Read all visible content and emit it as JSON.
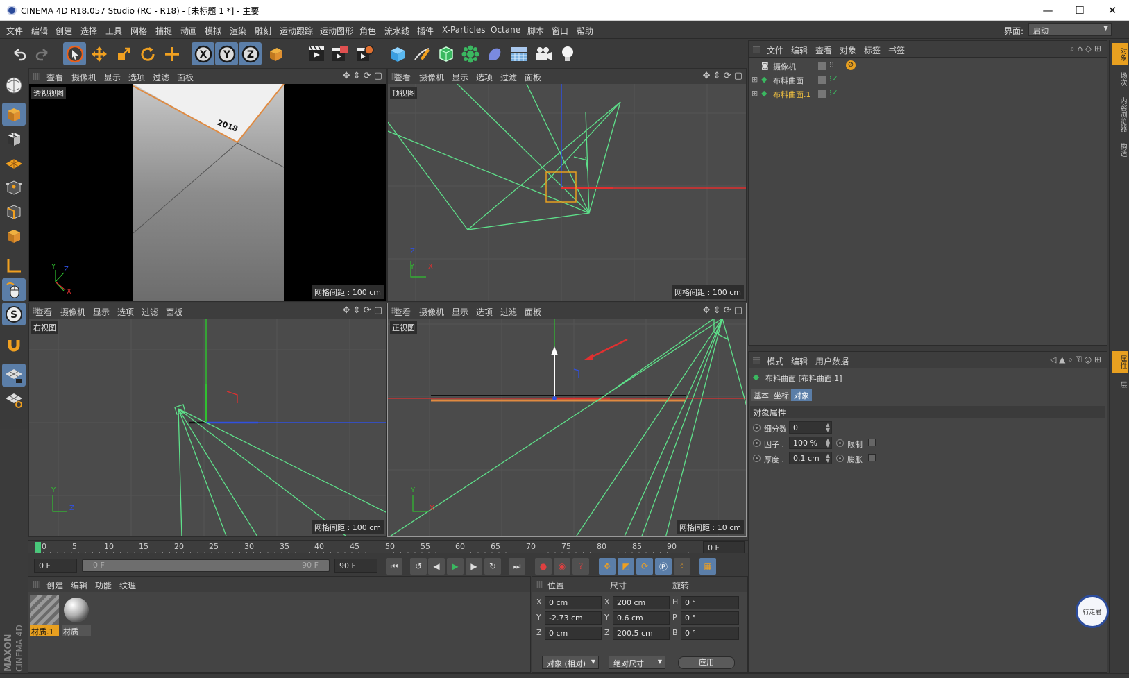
{
  "window": {
    "title": "CINEMA 4D R18.057 Studio (RC - R18) - [未标题 1 *] - 主要",
    "minimize": "—",
    "maximize": "☐",
    "close": "✕"
  },
  "menu": [
    "文件",
    "编辑",
    "创建",
    "选择",
    "工具",
    "网格",
    "捕捉",
    "动画",
    "模拟",
    "渲染",
    "雕刻",
    "运动跟踪",
    "运动图形",
    "角色",
    "流水线",
    "插件",
    "X-Particles",
    "Octane",
    "脚本",
    "窗口",
    "帮助"
  ],
  "layout": {
    "label": "界面:",
    "value": "启动"
  },
  "toolbar_icons": [
    "undo-icon",
    "redo-icon",
    "live-select-icon",
    "move-icon",
    "scale-icon",
    "rotate-icon",
    "add-icon",
    "x-axis-icon",
    "y-axis-icon",
    "z-axis-icon",
    "coordinate-system-icon",
    "render-view-icon",
    "render-picture-viewer-icon",
    "render-settings-icon",
    "cube-icon",
    "pen-icon",
    "subdivision-icon",
    "cloner-icon",
    "deformer-icon",
    "floor-icon",
    "camera-icon",
    "light-icon"
  ],
  "viewports": [
    {
      "name": "透视视图",
      "grid": "网格间距 : 100 cm",
      "axes": [
        "Y",
        "Z",
        "X"
      ]
    },
    {
      "name": "顶视图",
      "grid": "网格间距 : 100 cm",
      "axes": [
        "Z",
        "Y",
        "X"
      ]
    },
    {
      "name": "右视图",
      "grid": "网格间距 : 100 cm",
      "axes": [
        "Y",
        "Z"
      ]
    },
    {
      "name": "正视图",
      "grid": "网格间距 : 10 cm",
      "axes": [
        "Y",
        "X"
      ]
    }
  ],
  "viewport_menu": [
    "查看",
    "摄像机",
    "显示",
    "选项",
    "过滤",
    "面板"
  ],
  "perspective_text": "2018",
  "object_manager": {
    "menu": [
      "文件",
      "编辑",
      "查看",
      "对象",
      "标签",
      "书签"
    ],
    "objects": [
      {
        "name": "摄像机",
        "color": "#d8d8d8"
      },
      {
        "name": "布料曲面",
        "color": "#d8d8d8"
      },
      {
        "name": "布料曲面.1",
        "color": "#f0c040"
      }
    ]
  },
  "right_tabs": [
    "对象",
    "场次",
    "内容浏览器",
    "构造",
    "属性",
    "层"
  ],
  "attribute_manager": {
    "menu": [
      "模式",
      "编辑",
      "用户数据"
    ],
    "object_title": "布料曲面 [布料曲面.1]",
    "tabs": [
      "基本",
      "坐标",
      "对象"
    ],
    "active_tab": "对象",
    "section": "对象属性",
    "props": {
      "subdivisions_label": "细分数",
      "subdivisions_value": "0",
      "factor_label": "因子 .",
      "factor_value": "100 %",
      "limit_label": "限制",
      "thickness_label": "厚度 .",
      "thickness_value": "0.1 cm",
      "expand_label": "膨胀"
    }
  },
  "timeline": {
    "ticks": [
      "0",
      "5",
      "10",
      "15",
      "20",
      "25",
      "30",
      "35",
      "40",
      "45",
      "50",
      "55",
      "60",
      "65",
      "70",
      "75",
      "80",
      "85",
      "90"
    ],
    "current_frame": "0 F"
  },
  "transport": {
    "start": "0 F",
    "range_start": "0 F",
    "range_end": "90 F",
    "end": "90 F"
  },
  "material_manager": {
    "menu": [
      "创建",
      "编辑",
      "功能",
      "纹理"
    ],
    "materials": [
      {
        "name": "材质.1",
        "selected": true
      },
      {
        "name": "材质",
        "selected": false
      }
    ]
  },
  "coordinates": {
    "headers": [
      "位置",
      "尺寸",
      "旋转"
    ],
    "rows": [
      {
        "pl": "X",
        "pv": "0 cm",
        "sl": "X",
        "sv": "200 cm",
        "rl": "H",
        "rv": "0 °"
      },
      {
        "pl": "Y",
        "pv": "-2.73 cm",
        "sl": "Y",
        "sv": "0.6 cm",
        "rl": "P",
        "rv": "0 °"
      },
      {
        "pl": "Z",
        "pv": "0 cm",
        "sl": "Z",
        "sv": "200.5 cm",
        "rl": "B",
        "rv": "0 °"
      }
    ],
    "mode": "对象 (相对)",
    "size_mode": "绝对尺寸",
    "apply": "应用"
  },
  "branding": {
    "maxon": "MAXON",
    "c4d": "CINEMA 4D",
    "watermark": "行走君"
  },
  "colors": {
    "accent": "#5b7ea8",
    "selection": "#e8a020",
    "spline": "#5ee08a",
    "axis_x": "#e03030",
    "axis_y": "#30c030",
    "axis_z": "#3050e0"
  }
}
